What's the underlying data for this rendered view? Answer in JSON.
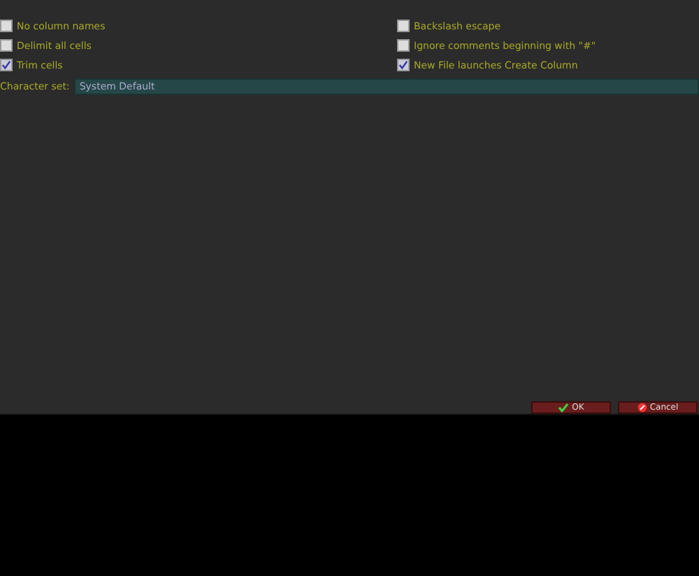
{
  "options_left": [
    {
      "label": "No column names",
      "checked": false
    },
    {
      "label": "Delimit all cells",
      "checked": false
    },
    {
      "label": "Trim cells",
      "checked": true
    }
  ],
  "options_right": [
    {
      "label": "Backslash escape",
      "checked": false
    },
    {
      "label": "Ignore comments beginning with \"#\"",
      "checked": false
    },
    {
      "label": "New File launches Create Column",
      "checked": true
    }
  ],
  "character_set": {
    "label": "Character set:",
    "value": "System Default"
  },
  "buttons": [
    {
      "kind": "ok",
      "label": "OK"
    },
    {
      "kind": "cancel",
      "label": "Cancel"
    }
  ]
}
